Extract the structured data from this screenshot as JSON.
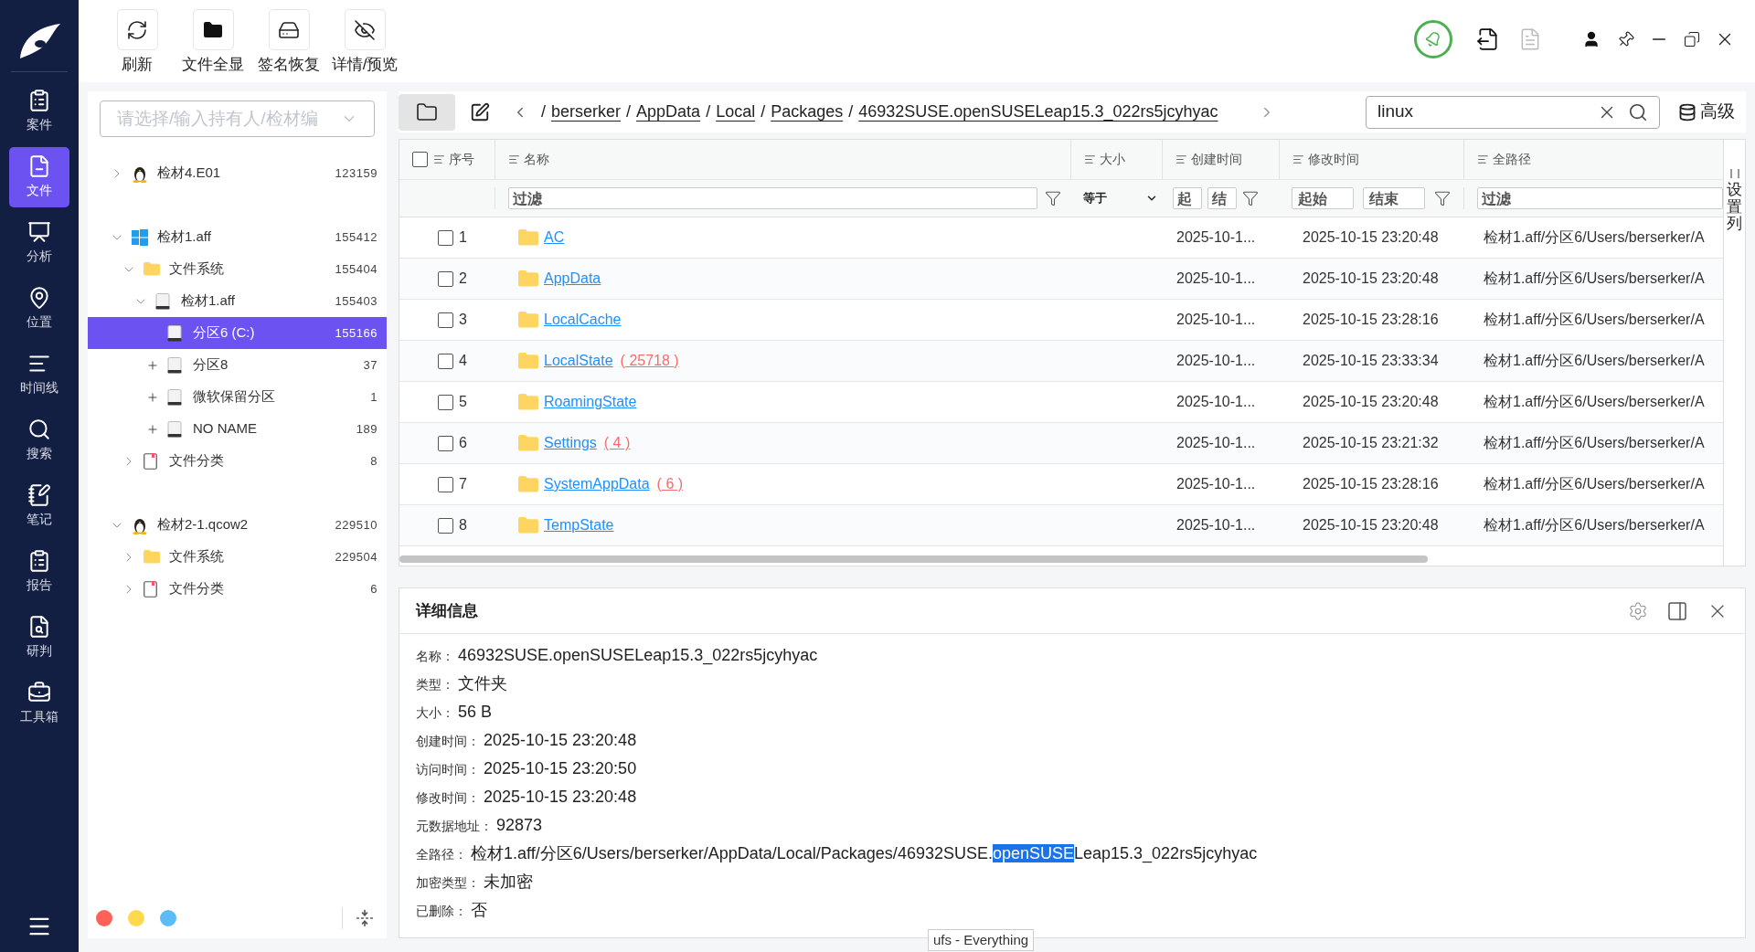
{
  "sidebar": {
    "items": [
      {
        "label": "案件",
        "selected": false
      },
      {
        "label": "文件",
        "selected": true
      },
      {
        "label": "分析",
        "selected": false
      },
      {
        "label": "位置",
        "selected": false
      },
      {
        "label": "时间线",
        "selected": false
      },
      {
        "label": "搜索",
        "selected": false
      },
      {
        "label": "笔记",
        "selected": false
      },
      {
        "label": "报告",
        "selected": false
      },
      {
        "label": "研判",
        "selected": false
      },
      {
        "label": "工具箱",
        "selected": false
      }
    ]
  },
  "toolbar": {
    "buttons": [
      {
        "label": "刷新"
      },
      {
        "label": "文件全显"
      },
      {
        "label": "签名恢复"
      },
      {
        "label": "详情/预览"
      }
    ]
  },
  "tree_panel": {
    "select": {
      "placeholder": "请选择/输入持有人/检材编"
    },
    "tree": [
      {
        "label": "检材4.E01",
        "count": "123159",
        "kind": "linux",
        "expanded": false,
        "selected": false
      },
      {
        "label": "检材1.aff",
        "count": "155412",
        "kind": "windows",
        "expanded": true,
        "selected": false,
        "children": [
          {
            "label": "文件系统",
            "count": "155404",
            "kind": "folder",
            "expanded": true,
            "selected": false,
            "children": [
              {
                "label": "检材1.aff",
                "count": "155403",
                "kind": "disk",
                "expanded": true,
                "selected": false,
                "children": [
                  {
                    "label": "分区6 (C:)",
                    "count": "155166",
                    "kind": "partition",
                    "selected": true
                  },
                  {
                    "label": "分区8",
                    "count": "37",
                    "kind": "partition",
                    "expanded": false,
                    "selected": false
                  },
                  {
                    "label": "微软保留分区",
                    "count": "1",
                    "kind": "partition",
                    "expanded": false,
                    "selected": false
                  },
                  {
                    "label": "NO NAME",
                    "count": "189",
                    "kind": "partition",
                    "expanded": false,
                    "selected": false
                  }
                ]
              }
            ]
          },
          {
            "label": "文件分类",
            "count": "8",
            "kind": "category",
            "expanded": false,
            "selected": false
          }
        ]
      },
      {
        "label": "检材2-1.qcow2",
        "count": "229510",
        "kind": "linux",
        "expanded": true,
        "selected": false,
        "children": [
          {
            "label": "文件系统",
            "count": "229504",
            "kind": "folder",
            "expanded": false,
            "selected": false
          },
          {
            "label": "文件分类",
            "count": "6",
            "kind": "category",
            "expanded": false,
            "selected": false
          }
        ]
      }
    ],
    "status_dots": [
      {
        "color": "#ff6159"
      },
      {
        "color": "#ffd84d"
      },
      {
        "color": "#5bbcf7"
      }
    ]
  },
  "path_bar": {
    "folder_button": {
      "selected": true
    },
    "separator": "/",
    "crumbs": [
      "berserker",
      "AppData",
      "Local",
      "Packages",
      "46932SUSE.openSUSELeap15.3_022rs5jcyhyac"
    ]
  },
  "search": {
    "value": "linux"
  },
  "advanced_button": "高级",
  "table": {
    "header_checkbox": {
      "checked": false
    },
    "columns": [
      "序号",
      "名称",
      "大小",
      "创建时间",
      "修改时间",
      "全路径"
    ],
    "filters": {
      "name": "过滤",
      "size_op": "等于",
      "created_start": "起",
      "created_end": "结",
      "modified_start": "起始",
      "modified_end": "结束",
      "path": "过滤"
    },
    "rows": [
      {
        "index": "1",
        "name": "AC",
        "created": "2025-10-1...",
        "modified": "2025-10-15 23:20:48",
        "path": "检材1.aff/分区6/Users/berserker/A",
        "checked": false
      },
      {
        "index": "2",
        "name": "AppData",
        "created": "2025-10-1...",
        "modified": "2025-10-15 23:20:48",
        "path": "检材1.aff/分区6/Users/berserker/A",
        "checked": false
      },
      {
        "index": "3",
        "name": "LocalCache",
        "created": "2025-10-1...",
        "modified": "2025-10-15 23:28:16",
        "path": "检材1.aff/分区6/Users/berserker/A",
        "checked": false
      },
      {
        "index": "4",
        "name": "LocalState",
        "count": "( 25718 )",
        "created": "2025-10-1...",
        "modified": "2025-10-15 23:33:34",
        "path": "检材1.aff/分区6/Users/berserker/A",
        "checked": false
      },
      {
        "index": "5",
        "name": "RoamingState",
        "created": "2025-10-1...",
        "modified": "2025-10-15 23:20:48",
        "path": "检材1.aff/分区6/Users/berserker/A",
        "checked": false
      },
      {
        "index": "6",
        "name": "Settings",
        "count": "( 4 )",
        "created": "2025-10-1...",
        "modified": "2025-10-15 23:21:32",
        "path": "检材1.aff/分区6/Users/berserker/A",
        "checked": false
      },
      {
        "index": "7",
        "name": "SystemAppData",
        "count": "( 6 )",
        "created": "2025-10-1...",
        "modified": "2025-10-15 23:28:16",
        "path": "检材1.aff/分区6/Users/berserker/A",
        "checked": false
      },
      {
        "index": "8",
        "name": "TempState",
        "created": "2025-10-1...",
        "modified": "2025-10-15 23:20:48",
        "path": "检材1.aff/分区6/Users/berserker/A",
        "checked": false
      }
    ],
    "column_settings": "设置列"
  },
  "details": {
    "title": "详细信息",
    "fields": [
      {
        "label": "名称：",
        "value": "46932SUSE.openSUSELeap15.3_022rs5jcyhyac"
      },
      {
        "label": "类型：",
        "value": "文件夹"
      },
      {
        "label": "大小：",
        "value": "56 B"
      },
      {
        "label": "创建时间：",
        "value": "2025-10-15 23:20:48"
      },
      {
        "label": "访问时间：",
        "value": "2025-10-15 23:20:50"
      },
      {
        "label": "修改时间：",
        "value": "2025-10-15 23:20:48"
      },
      {
        "label": "元数据地址：",
        "value": "92873"
      },
      {
        "label": "全路径：",
        "segments": [
          {
            "text": "检材1.aff/分区6/Users/berserker/AppData/Local/Packages/46932SUSE.",
            "selected": false
          },
          {
            "text": "openSUSE",
            "selected": true
          },
          {
            "text": "Leap15.3_022rs5jcyhyac",
            "selected": false
          }
        ]
      },
      {
        "label": "加密类型：",
        "value": "未加密"
      },
      {
        "label": "已删除：",
        "value": "否"
      }
    ]
  },
  "tooltip": "ufs - Everything"
}
